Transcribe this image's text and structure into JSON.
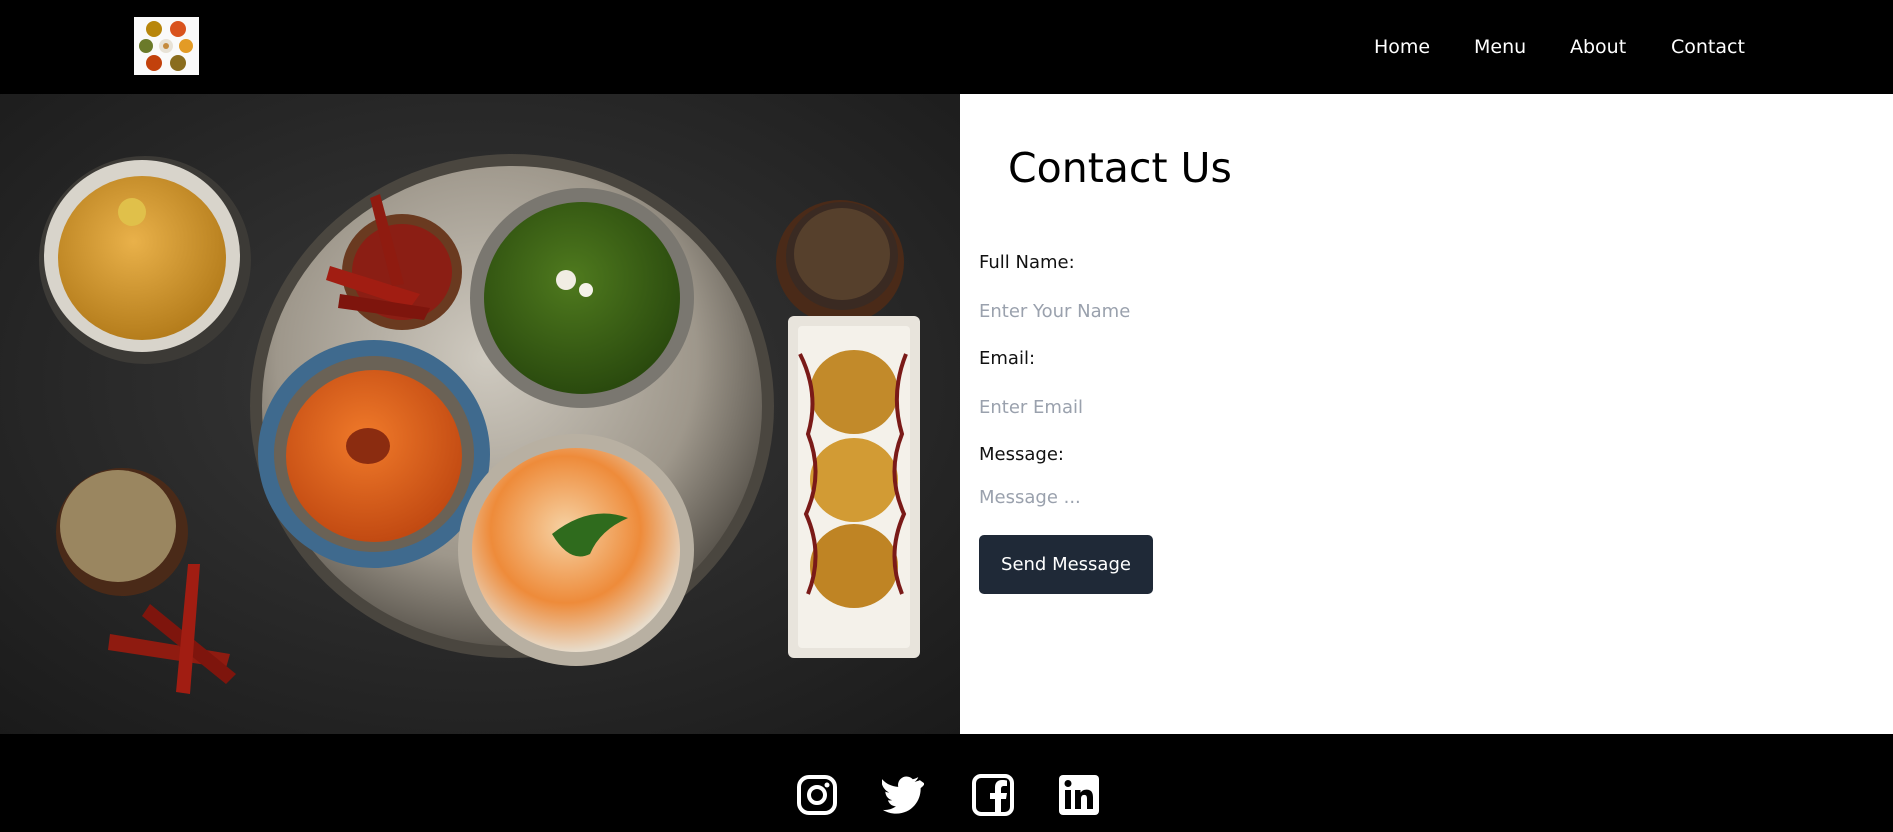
{
  "nav": {
    "links": [
      "Home",
      "Menu",
      "About",
      "Contact"
    ]
  },
  "contact": {
    "title": "Contact Us",
    "name_label": "Full Name:",
    "name_placeholder": "Enter Your Name",
    "email_label": "Email:",
    "email_placeholder": "Enter Email",
    "message_label": "Message:",
    "message_placeholder": "Message ...",
    "submit_label": "Send Message"
  },
  "footer": {
    "social_icons": [
      "instagram-icon",
      "twitter-icon",
      "facebook-icon",
      "linkedin-icon"
    ]
  },
  "colors": {
    "nav_bg": "#000000",
    "button_bg": "#1f2937",
    "placeholder": "#9aa1ad"
  }
}
